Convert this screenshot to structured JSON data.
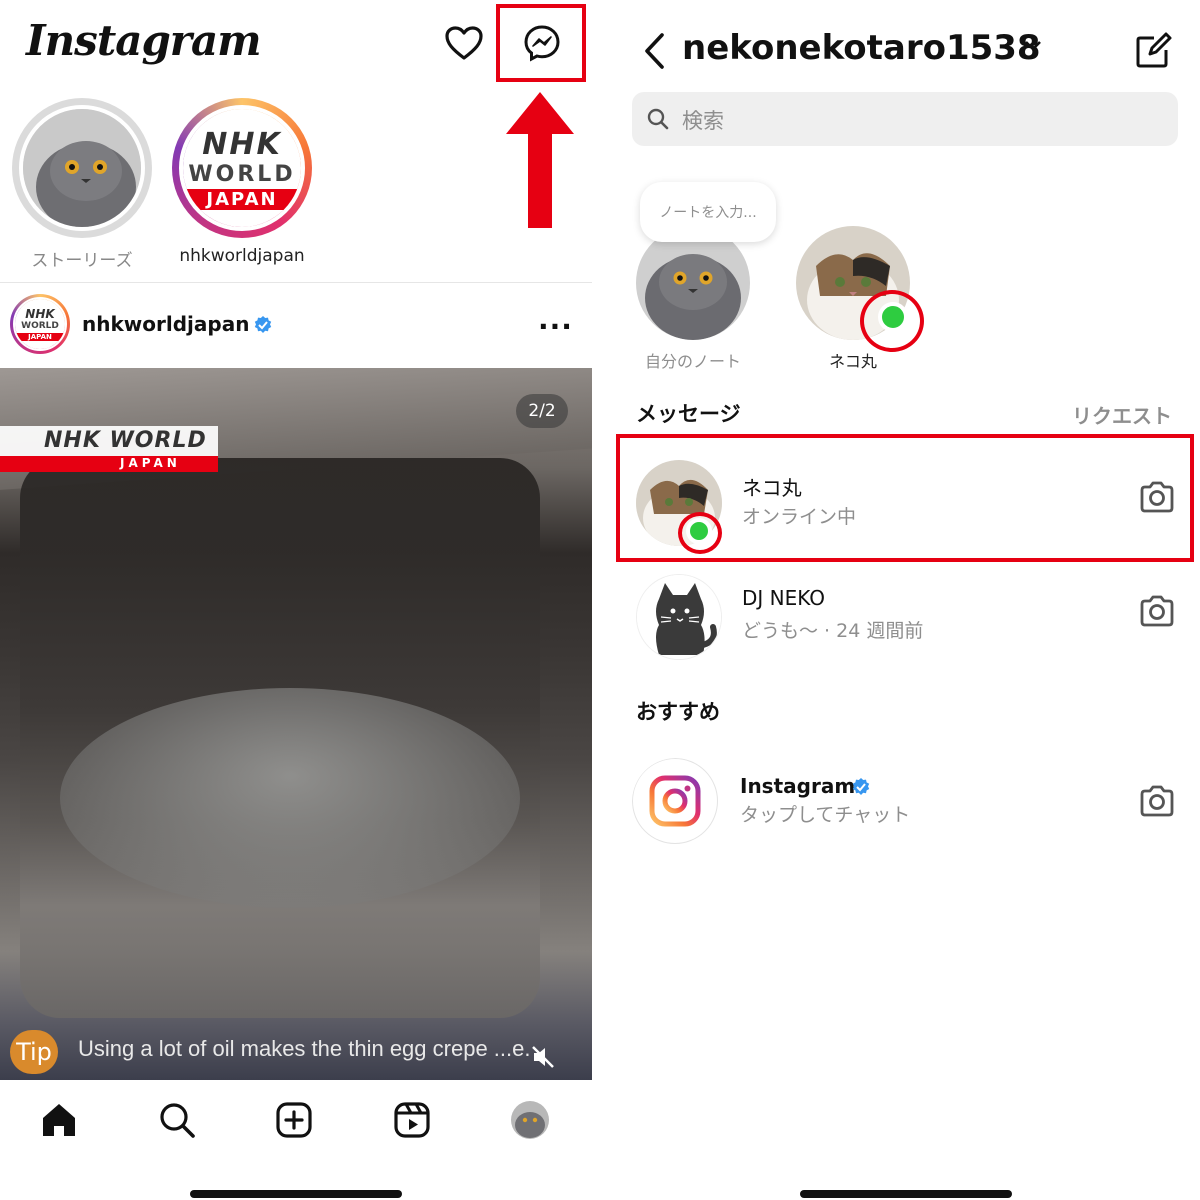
{
  "left": {
    "app_logo": "Instagram",
    "stories": [
      {
        "label": "ストーリーズ"
      },
      {
        "label": "nhkworldjapan"
      }
    ],
    "nhk_logo": {
      "line1": "NHK",
      "line2": "WORLD",
      "line3": "JAPAN"
    },
    "post": {
      "username": "nhkworldjapan",
      "counter": "2/2",
      "banner_line1": "NHK WORLD",
      "banner_line2": "JAPAN",
      "tip": "Tip",
      "caption": "Using a lot of oil makes the thin egg crepe ...e."
    },
    "nav": [
      "home-icon",
      "search-icon",
      "create-icon",
      "reels-icon",
      "profile-avatar"
    ]
  },
  "right": {
    "username": "nekonekotaro1538",
    "search_placeholder": "検索",
    "note_bubble": "ノートを入力...",
    "notes": [
      {
        "label": "自分のノート"
      },
      {
        "label": "ネコ丸"
      }
    ],
    "messages_title": "メッセージ",
    "requests_label": "リクエスト",
    "chats": [
      {
        "name": "ネコ丸",
        "sub": "オンライン中"
      },
      {
        "name": "DJ NEKO",
        "sub": "どうも〜 · 24 週間前"
      }
    ],
    "suggested_title": "おすすめ",
    "suggested": [
      {
        "name": "Instagram",
        "sub": "タップしてチャット"
      }
    ]
  },
  "colors": {
    "highlight_red": "#e60012",
    "online_green": "#2ecc40",
    "verified_blue": "#3897f0",
    "muted_gray": "#8e8e8e"
  }
}
